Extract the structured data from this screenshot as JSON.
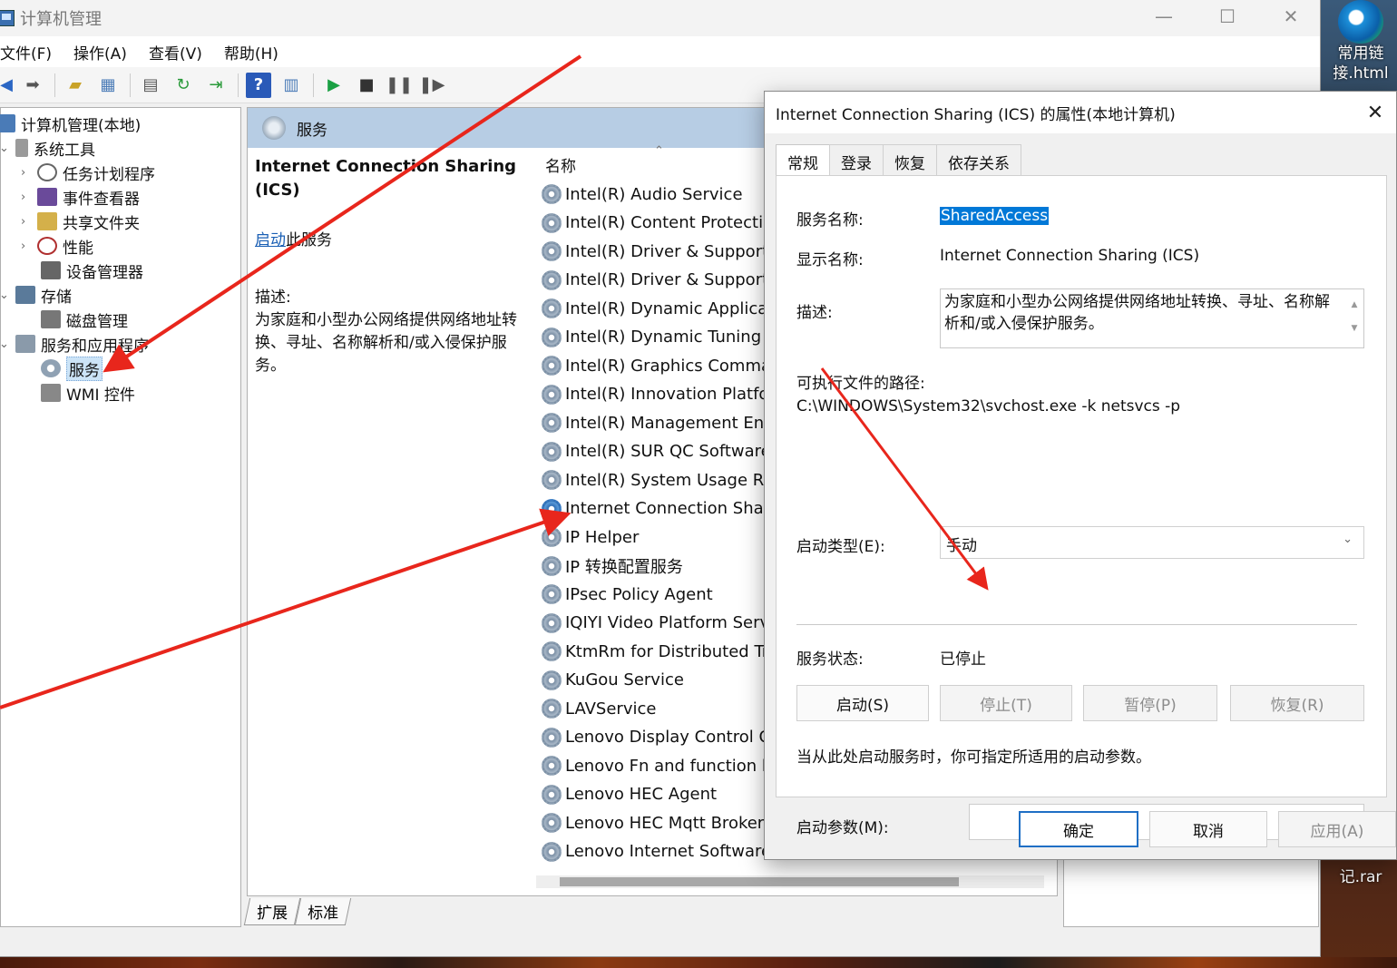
{
  "window": {
    "title": "计算机管理"
  },
  "menu": [
    "文件(F)",
    "操作(A)",
    "查看(V)",
    "帮助(H)"
  ],
  "tree": {
    "root": "计算机管理(本地)",
    "system_tools": "系统工具",
    "task_scheduler": "任务计划程序",
    "event_viewer": "事件查看器",
    "shared_folders": "共享文件夹",
    "performance": "性能",
    "device_manager": "设备管理器",
    "storage": "存储",
    "disk_management": "磁盘管理",
    "services_apps": "服务和应用程序",
    "services": "服务",
    "wmi": "WMI 控件"
  },
  "center": {
    "header": "服务",
    "selected_title": "Internet Connection Sharing (ICS)",
    "start_link": "启动",
    "start_suffix": "此服务",
    "desc_label": "描述:",
    "desc_text": "为家庭和小型办公网络提供网络地址转换、寻址、名称解析和/或入侵保护服务。",
    "col_name": "名称",
    "services": [
      "Intel(R) Audio Service",
      "Intel(R) Content Protection",
      "Intel(R) Driver & Support A",
      "Intel(R) Driver & Support A",
      "Intel(R) Dynamic Applicati...",
      "Intel(R) Dynamic Tuning T...",
      "Intel(R) Graphics Comman...",
      "Intel(R) Innovation Platfor...",
      "Intel(R) Management Engi...",
      "Intel(R) SUR QC Software ...",
      "Intel(R) System Usage Rep",
      "Internet Connection Sharin",
      "IP Helper",
      "IP 转换配置服务",
      "IPsec Policy Agent",
      "IQIYI Video Platform Servic",
      "KtmRm for Distributed Tra...",
      "KuGou Service",
      "LAVService",
      "Lenovo Display Control Ce...",
      "Lenovo Fn and function ke...",
      "Lenovo HEC Agent",
      "Lenovo HEC Mqtt Broker",
      "Lenovo Internet Software F"
    ],
    "tab_extended": "扩展",
    "tab_standard": "标准"
  },
  "desktop": {
    "icon1": "常用链接.html",
    "icon2": "记.rar"
  },
  "dialog": {
    "title": "Internet Connection Sharing (ICS) 的属性(本地计算机)",
    "tabs": [
      "常规",
      "登录",
      "恢复",
      "依存关系"
    ],
    "service_name_label": "服务名称:",
    "service_name": "SharedAccess",
    "display_name_label": "显示名称:",
    "display_name": "Internet Connection Sharing (ICS)",
    "desc_label": "描述:",
    "desc": "为家庭和小型办公网络提供网络地址转换、寻址、名称解析和/或入侵保护服务。",
    "path_label": "可执行文件的路径:",
    "path": "C:\\WINDOWS\\System32\\svchost.exe -k netsvcs -p",
    "startup_type_label": "启动类型(E):",
    "startup_type": "手动",
    "status_label": "服务状态:",
    "status": "已停止",
    "btn_start": "启动(S)",
    "btn_stop": "停止(T)",
    "btn_pause": "暂停(P)",
    "btn_resume": "恢复(R)",
    "hint": "当从此处启动服务时，你可指定所适用的启动参数。",
    "param_label": "启动参数(M):",
    "btn_ok": "确定",
    "btn_cancel": "取消",
    "btn_apply": "应用(A)"
  }
}
